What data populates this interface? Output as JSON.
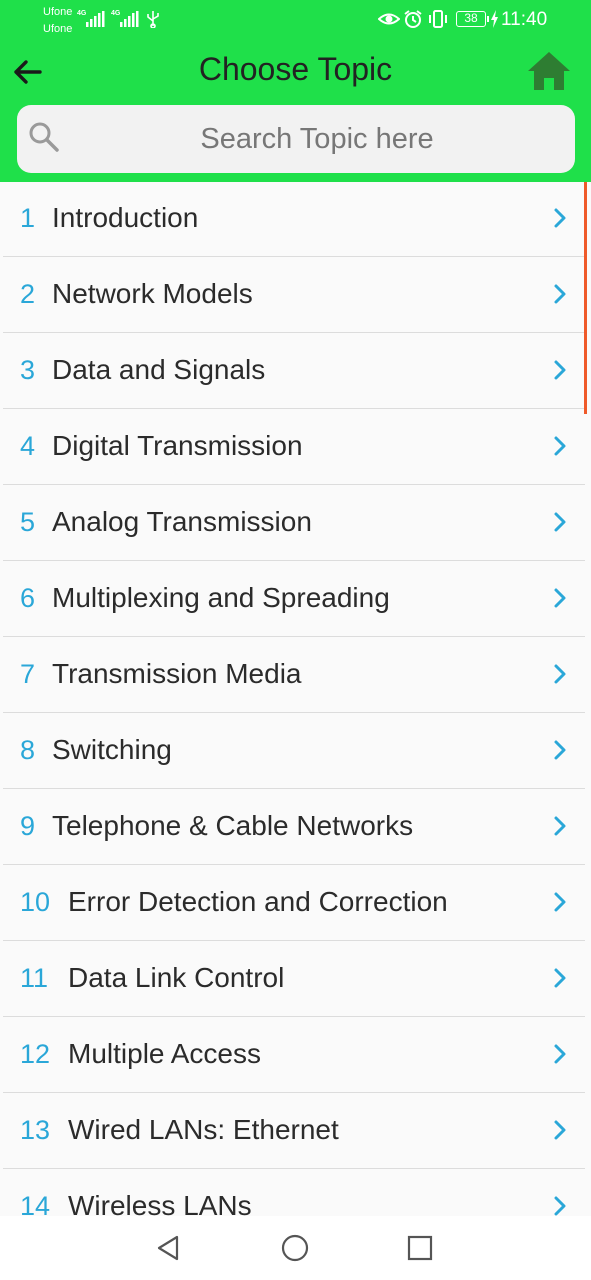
{
  "status_bar": {
    "carrier_1": "Ufone",
    "carrier_2": "Ufone",
    "network_1": "4G",
    "network_2": "4G",
    "battery": "38",
    "time": "11:40"
  },
  "app_bar": {
    "title": "Choose Topic",
    "back_icon": "arrow-left-icon",
    "home_icon": "home-icon",
    "color": "#1fe04a"
  },
  "search": {
    "placeholder": "Search Topic here",
    "value": "",
    "icon": "search-icon"
  },
  "topics": [
    {
      "number": "1",
      "label": "Introduction"
    },
    {
      "number": "2",
      "label": "Network Models"
    },
    {
      "number": "3",
      "label": "Data and Signals"
    },
    {
      "number": "4",
      "label": "Digital Transmission"
    },
    {
      "number": "5",
      "label": "Analog Transmission"
    },
    {
      "number": "6",
      "label": "Multiplexing and Spreading"
    },
    {
      "number": "7",
      "label": "Transmission Media"
    },
    {
      "number": "8",
      "label": "Switching"
    },
    {
      "number": "9",
      "label": "Telephone & Cable Networks"
    },
    {
      "number": "10",
      "label": "Error Detection and Correction"
    },
    {
      "number": "11",
      "label": "Data Link Control"
    },
    {
      "number": "12",
      "label": "Multiple Access"
    },
    {
      "number": "13",
      "label": "Wired LANs: Ethernet"
    },
    {
      "number": "14",
      "label": "Wireless LANs"
    }
  ],
  "colors": {
    "number": "#2aa7d8",
    "chevron": "#2aa7d8",
    "scroll_indicator": "#ef5a2a"
  },
  "nav_bar": {
    "back": "triangle-back-icon",
    "home": "circle-home-icon",
    "recents": "square-recents-icon"
  }
}
